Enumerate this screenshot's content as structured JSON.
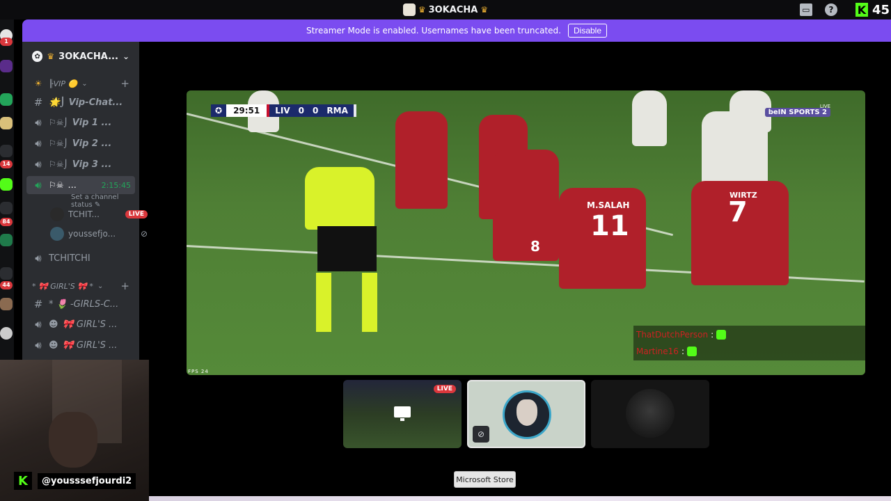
{
  "topbar": {
    "server_title": "3OKACHA",
    "count": "45"
  },
  "banner": {
    "text": "Streamer Mode is enabled. Usernames have been truncated.",
    "button": "Disable"
  },
  "rail": {
    "badges": [
      "1",
      "14",
      "84",
      "44"
    ]
  },
  "sidebar": {
    "server_name": "3OKACHA...",
    "vip_category": "╟VIP 🟡",
    "girls_category": "* 🎀 GIRL'S 🎀 *",
    "channels": [
      {
        "type": "text",
        "label": "🌟⌡ Vip-Chat..."
      },
      {
        "type": "voice",
        "label": "Vip 1 ..."
      },
      {
        "type": "voice",
        "label": "Vip 2 ..."
      },
      {
        "type": "voice",
        "label": "Vip 3 ..."
      }
    ],
    "active_channel": {
      "label": "...",
      "timer": "2:15:45",
      "status_hint": "Set a channel status"
    },
    "users": [
      {
        "name": "TCHIT...",
        "badge": "LIVE"
      },
      {
        "name": "youssefjo..."
      }
    ],
    "tchitchi": "TCHITCHI",
    "girls_channels": [
      {
        "type": "text",
        "label": "* 🌷 -GIRLS-C..."
      },
      {
        "type": "voice",
        "label": "🎀 GIRL'S ..."
      },
      {
        "type": "voice",
        "label": "🎀 GIRL'S ..."
      }
    ]
  },
  "webcam": {
    "handle": "@yousssefjourdi2"
  },
  "video": {
    "match": {
      "clock": "29:51",
      "home": "LIV",
      "home_score": "0",
      "away_score": "0",
      "away": "RMA"
    },
    "broadcaster": "beIN SPORTS 2",
    "live_tag": "LIVE",
    "fps": "FPS 24",
    "players": [
      {
        "name": "M.SALAH",
        "number": "11"
      },
      {
        "name": "WIRTZ",
        "number": "7"
      },
      {
        "name": "",
        "number": "8"
      }
    ],
    "chat": [
      {
        "user": "ThatDutchPerson"
      },
      {
        "user": "Martine16"
      }
    ]
  },
  "tiles": {
    "live_badge": "LIVE"
  },
  "tooltip": {
    "text": "Microsoft Store"
  }
}
